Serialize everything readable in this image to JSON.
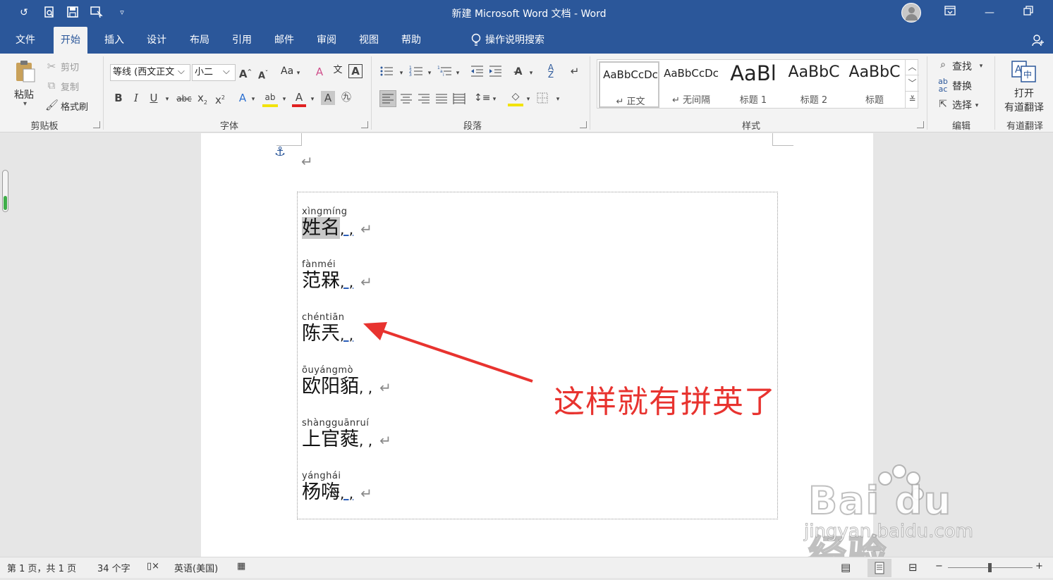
{
  "window": {
    "title": "新建 Microsoft Word 文档 - Word",
    "icons": [
      "undo-icon",
      "print-preview-icon",
      "save-icon",
      "touch-mode-icon",
      "customize-qat-icon",
      "account-avatar",
      "ribbon-display-icon",
      "minimize-icon",
      "restore-icon"
    ]
  },
  "tabs": [
    "文件",
    "开始",
    "插入",
    "设计",
    "布局",
    "引用",
    "邮件",
    "审阅",
    "视图",
    "帮助"
  ],
  "active_tab": "开始",
  "tell_me": "操作说明搜索",
  "ribbon": {
    "clipboard": {
      "paste": "粘贴",
      "cut": "剪切",
      "copy": "复制",
      "format_painter": "格式刷",
      "label": "剪贴板"
    },
    "font": {
      "font_name": "等线 (西文正文",
      "font_size": "小二",
      "case": "Aa",
      "label": "字体"
    },
    "paragraph": {
      "label": "段落"
    },
    "styles": {
      "items": [
        {
          "preview": "AaBbCcDc",
          "name": "正文"
        },
        {
          "preview": "AaBbCcDc",
          "name": "无间隔"
        },
        {
          "preview": "AaBl",
          "name": "标题 1"
        },
        {
          "preview": "AaBbC",
          "name": "标题 2"
        },
        {
          "preview": "AaBbC",
          "name": "标题"
        }
      ],
      "label": "样式"
    },
    "editing": {
      "find": "查找",
      "replace": "替换",
      "select": "选择",
      "label": "编辑"
    },
    "youdao": {
      "open": "打开",
      "open2": "有道翻译",
      "label": "有道翻译"
    }
  },
  "document": {
    "entries": [
      {
        "pinyin": "xìngmíng",
        "hanzi": "姓名",
        "suffix": ", ,"
      },
      {
        "pinyin": "fànméi",
        "hanzi": "范槑",
        "suffix": ", ,"
      },
      {
        "pinyin": "chéntiān",
        "hanzi": "陈兲",
        "suffix": ", ,"
      },
      {
        "pinyin": "ōuyángmò",
        "hanzi": "欧阳貊",
        "suffix": ", ,"
      },
      {
        "pinyin": "shàngguānruí",
        "hanzi": "上官蕤",
        "suffix": ", ,"
      },
      {
        "pinyin": "yánghái",
        "hanzi": "杨嗨",
        "suffix": ", ,"
      }
    ],
    "annotation": "这样就有拼英了",
    "annotation_color": "#e8332f"
  },
  "watermark": {
    "text": "Bai du 经验",
    "url": "jingyan.baidu.com"
  },
  "status": {
    "page": "第 1 页，共 1 页",
    "words": "34 个字",
    "language": "英语(美国)"
  },
  "colors": {
    "accent": "#2b579a"
  }
}
